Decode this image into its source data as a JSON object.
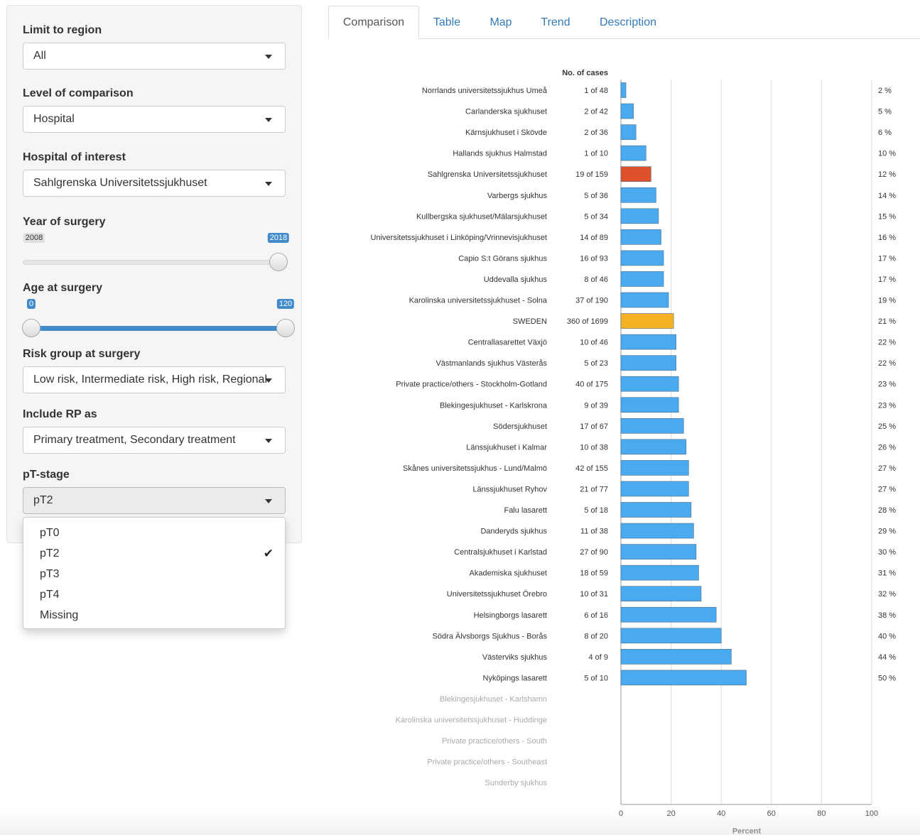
{
  "sidebar": {
    "region": {
      "label": "Limit to region",
      "value": "All"
    },
    "level": {
      "label": "Level of comparison",
      "value": "Hospital"
    },
    "hospital": {
      "label": "Hospital of interest",
      "value": "Sahlgrenska Universitetssjukhuset"
    },
    "year": {
      "label": "Year of surgery",
      "min_label": "2008",
      "value_label": "2018",
      "min": 2008,
      "max": 2018,
      "value": 2018
    },
    "age": {
      "label": "Age at surgery",
      "low_label": "0",
      "high_label": "120",
      "min": 0,
      "max": 120,
      "low": 0,
      "high": 120
    },
    "risk": {
      "label": "Risk group at surgery",
      "value": "Low risk, Intermediate risk, High risk, Regional"
    },
    "rp": {
      "label": "Include RP as",
      "value": "Primary treatment, Secondary treatment"
    },
    "pt": {
      "label": "pT-stage",
      "value": "pT2",
      "options": [
        {
          "label": "pT0",
          "selected": false
        },
        {
          "label": "pT2",
          "selected": true
        },
        {
          "label": "pT3",
          "selected": false
        },
        {
          "label": "pT4",
          "selected": false
        },
        {
          "label": "Missing",
          "selected": false
        }
      ],
      "check_glyph": "✔"
    }
  },
  "tabs": [
    {
      "label": "Comparison",
      "active": true
    },
    {
      "label": "Table",
      "active": false
    },
    {
      "label": "Map",
      "active": false
    },
    {
      "label": "Trend",
      "active": false
    },
    {
      "label": "Description",
      "active": false
    }
  ],
  "chart_data": {
    "type": "bar",
    "orientation": "horizontal",
    "cases_header": "No. of cases",
    "xlabel": "Percent",
    "xlim": [
      0,
      100
    ],
    "xticks": [
      0,
      20,
      40,
      60,
      80,
      100
    ],
    "grid": true,
    "colors": {
      "default": "#4aaaf0",
      "highlight": "#e0502a",
      "national": "#f5b324",
      "nodata": "#aaaaaa"
    },
    "categories": [
      {
        "name": "Norrlands universitetssjukhus Umeå",
        "cases": "1 of 48",
        "value": 2,
        "pct_label": "2 %",
        "kind": "default"
      },
      {
        "name": "Carlanderska sjukhuset",
        "cases": "2 of 42",
        "value": 5,
        "pct_label": "5 %",
        "kind": "default"
      },
      {
        "name": "Kärnsjukhuset i Skövde",
        "cases": "2 of 36",
        "value": 6,
        "pct_label": "6 %",
        "kind": "default"
      },
      {
        "name": "Hallands sjukhus Halmstad",
        "cases": "1 of 10",
        "value": 10,
        "pct_label": "10 %",
        "kind": "default"
      },
      {
        "name": "Sahlgrenska Universitetssjukhuset",
        "cases": "19 of 159",
        "value": 12,
        "pct_label": "12 %",
        "kind": "highlight"
      },
      {
        "name": "Varbergs sjukhus",
        "cases": "5 of 36",
        "value": 14,
        "pct_label": "14 %",
        "kind": "default"
      },
      {
        "name": "Kullbergska sjukhuset/Mälarsjukhuset",
        "cases": "5 of 34",
        "value": 15,
        "pct_label": "15 %",
        "kind": "default"
      },
      {
        "name": "Universitetssjukhuset i Linköping/Vrinnevisjukhuset",
        "cases": "14 of 89",
        "value": 16,
        "pct_label": "16 %",
        "kind": "default"
      },
      {
        "name": "Capio S:t Görans sjukhus",
        "cases": "16 of 93",
        "value": 17,
        "pct_label": "17 %",
        "kind": "default"
      },
      {
        "name": "Uddevalla sjukhus",
        "cases": "8 of 46",
        "value": 17,
        "pct_label": "17 %",
        "kind": "default"
      },
      {
        "name": "Karolinska universitetssjukhuset - Solna",
        "cases": "37 of 190",
        "value": 19,
        "pct_label": "19 %",
        "kind": "default"
      },
      {
        "name": "SWEDEN",
        "cases": "360 of 1699",
        "value": 21,
        "pct_label": "21 %",
        "kind": "national"
      },
      {
        "name": "Centrallasarettet Växjö",
        "cases": "10 of 46",
        "value": 22,
        "pct_label": "22 %",
        "kind": "default"
      },
      {
        "name": "Västmanlands sjukhus Västerås",
        "cases": "5 of 23",
        "value": 22,
        "pct_label": "22 %",
        "kind": "default"
      },
      {
        "name": "Private practice/others - Stockholm-Gotland",
        "cases": "40 of 175",
        "value": 23,
        "pct_label": "23 %",
        "kind": "default"
      },
      {
        "name": "Blekingesjukhuset - Karlskrona",
        "cases": "9 of 39",
        "value": 23,
        "pct_label": "23 %",
        "kind": "default"
      },
      {
        "name": "Södersjukhuset",
        "cases": "17 of 67",
        "value": 25,
        "pct_label": "25 %",
        "kind": "default"
      },
      {
        "name": "Länssjukhuset i Kalmar",
        "cases": "10 of 38",
        "value": 26,
        "pct_label": "26 %",
        "kind": "default"
      },
      {
        "name": "Skånes universitetssjukhus - Lund/Malmö",
        "cases": "42 of 155",
        "value": 27,
        "pct_label": "27 %",
        "kind": "default"
      },
      {
        "name": "Länssjukhuset Ryhov",
        "cases": "21 of 77",
        "value": 27,
        "pct_label": "27 %",
        "kind": "default"
      },
      {
        "name": "Falu lasarett",
        "cases": "5 of 18",
        "value": 28,
        "pct_label": "28 %",
        "kind": "default"
      },
      {
        "name": "Danderyds sjukhus",
        "cases": "11 of 38",
        "value": 29,
        "pct_label": "29 %",
        "kind": "default"
      },
      {
        "name": "Centralsjukhuset i Karlstad",
        "cases": "27 of 90",
        "value": 30,
        "pct_label": "30 %",
        "kind": "default"
      },
      {
        "name": "Akademiska sjukhuset",
        "cases": "18 of 59",
        "value": 31,
        "pct_label": "31 %",
        "kind": "default"
      },
      {
        "name": "Universitetssjukhuset Örebro",
        "cases": "10 of 31",
        "value": 32,
        "pct_label": "32 %",
        "kind": "default"
      },
      {
        "name": "Helsingborgs lasarett",
        "cases": "6 of 16",
        "value": 38,
        "pct_label": "38 %",
        "kind": "default"
      },
      {
        "name": "Södra Älvsborgs Sjukhus - Borås",
        "cases": "8 of 20",
        "value": 40,
        "pct_label": "40 %",
        "kind": "default"
      },
      {
        "name": "Västerviks sjukhus",
        "cases": "4 of 9",
        "value": 44,
        "pct_label": "44 %",
        "kind": "default"
      },
      {
        "name": "Nyköpings lasarett",
        "cases": "5 of 10",
        "value": 50,
        "pct_label": "50 %",
        "kind": "default"
      },
      {
        "name": "Blekingesjukhuset - Karlshamn",
        "cases": "",
        "value": null,
        "pct_label": "",
        "kind": "nodata"
      },
      {
        "name": "Karolinska universitetssjukhuset - Huddinge",
        "cases": "",
        "value": null,
        "pct_label": "",
        "kind": "nodata"
      },
      {
        "name": "Private practice/others - South",
        "cases": "",
        "value": null,
        "pct_label": "",
        "kind": "nodata"
      },
      {
        "name": "Private practice/others - Southeast",
        "cases": "",
        "value": null,
        "pct_label": "",
        "kind": "nodata"
      },
      {
        "name": "Sunderby sjukhus",
        "cases": "",
        "value": null,
        "pct_label": "",
        "kind": "nodata"
      }
    ]
  }
}
